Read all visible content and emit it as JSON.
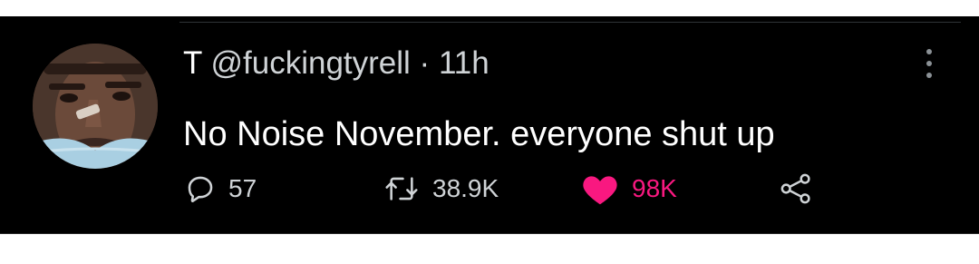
{
  "tweet": {
    "name": "T",
    "handle": "@fuckingtyrell",
    "separator": "·",
    "time": "11h",
    "text": "No Noise November. everyone shut up",
    "actions": {
      "replies": "57",
      "retweets": "38.9K",
      "likes": "98K"
    },
    "liked": true
  },
  "colors": {
    "background": "#000000",
    "text": "#ffffff",
    "muted": "#cfd3d6",
    "like": "#f91880"
  },
  "icons": [
    "more-icon",
    "reply-icon",
    "retweet-icon",
    "heart-icon",
    "share-icon"
  ]
}
